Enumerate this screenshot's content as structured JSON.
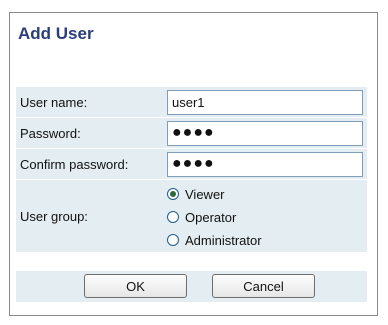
{
  "dialog": {
    "title": "Add User"
  },
  "form": {
    "username": {
      "label": "User name:",
      "value": "user1"
    },
    "password": {
      "label": "Password:",
      "value": "●●●●"
    },
    "confirm_password": {
      "label": "Confirm password:",
      "value": "●●●●"
    },
    "user_group": {
      "label": "User group:",
      "selected": "Viewer",
      "options": [
        "Viewer",
        "Operator",
        "Administrator"
      ]
    }
  },
  "buttons": {
    "ok": "OK",
    "cancel": "Cancel"
  },
  "colors": {
    "title": "#2a3f7a",
    "row_background": "#e4edf1",
    "input_border": "#7f9db9"
  }
}
